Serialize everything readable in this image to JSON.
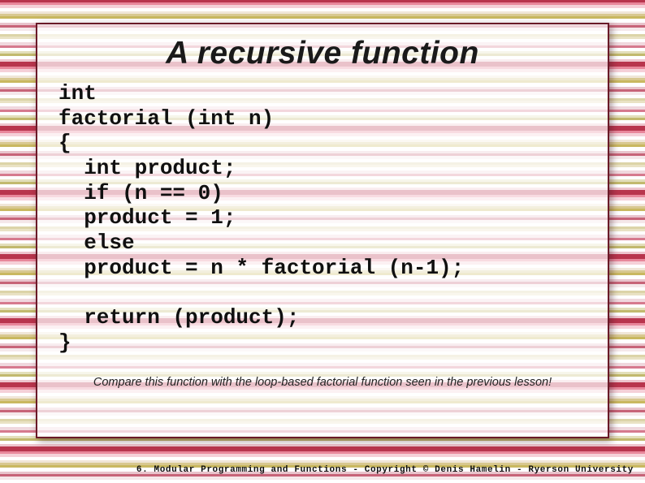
{
  "slide": {
    "title": "A recursive function",
    "code_lines": [
      "int",
      "factorial (int n)",
      "{",
      "  int product;",
      "  if (n == 0)",
      "  product = 1;",
      "  else",
      "  product = n * factorial (n-1);",
      "",
      "  return (product);",
      "}"
    ],
    "note": "Compare this function with the loop-based factorial function seen in the previous lesson!",
    "footer": "6. Modular Programming and Functions - Copyright © Denis Hamelin - Ryerson University"
  }
}
